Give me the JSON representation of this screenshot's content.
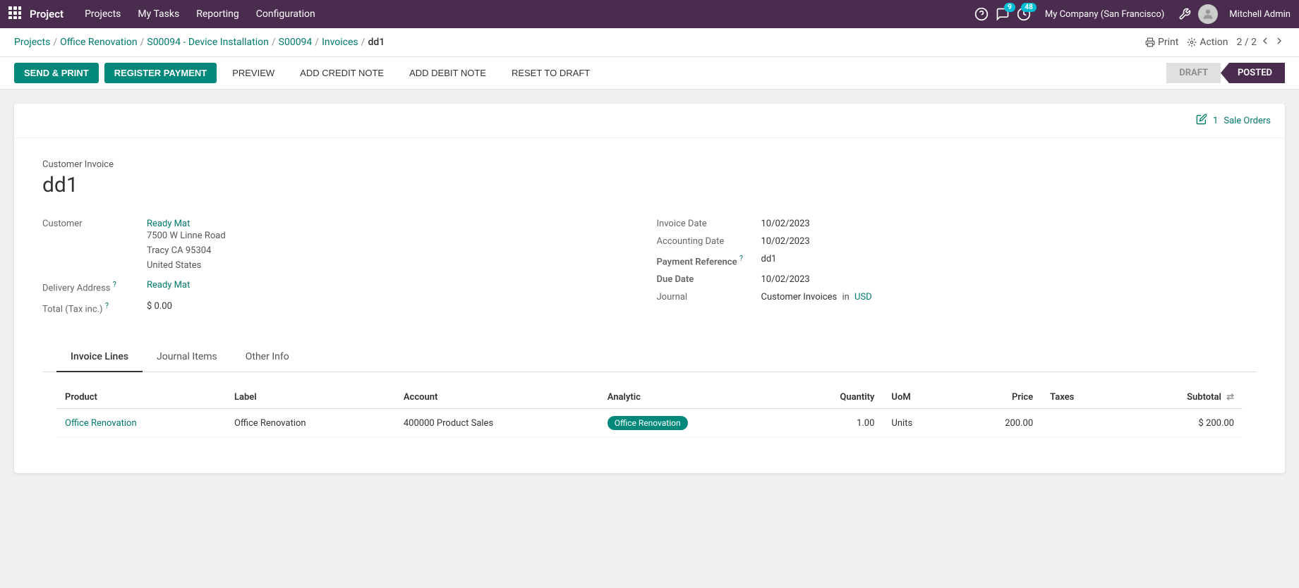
{
  "app": {
    "name": "Project",
    "nav_items": [
      "Projects",
      "My Tasks",
      "Reporting",
      "Configuration"
    ],
    "company": "My Company (San Francisco)",
    "user": "Mitchell Admin",
    "notifications_count": "9",
    "activity_count": "48"
  },
  "breadcrumb": {
    "items": [
      "Projects",
      "Office Renovation",
      "S00094 - Device Installation",
      "S00094",
      "Invoices",
      "dd1"
    ],
    "separators": [
      "/",
      "/",
      "/",
      "/",
      "/"
    ],
    "print_label": "Print",
    "action_label": "Action",
    "page_current": "2",
    "page_total": "2"
  },
  "toolbar": {
    "send_print_label": "SEND & PRINT",
    "register_payment_label": "REGISTER PAYMENT",
    "preview_label": "PREVIEW",
    "add_credit_note_label": "ADD CREDIT NOTE",
    "add_debit_note_label": "ADD DEBIT NOTE",
    "reset_to_draft_label": "RESET TO DRAFT",
    "status_draft": "DRAFT",
    "status_posted": "POSTED"
  },
  "sale_orders": {
    "count": "1",
    "label": "Sale Orders"
  },
  "invoice": {
    "type": "Customer Invoice",
    "title": "dd1",
    "customer_label": "Customer",
    "customer_name": "Ready Mat",
    "customer_address_line1": "7500 W Linne Road",
    "customer_address_line2": "Tracy CA 95304",
    "customer_address_line3": "United States",
    "delivery_address_label": "Delivery Address",
    "delivery_address_value": "Ready Mat",
    "total_label": "Total (Tax inc.)",
    "total_help": "?",
    "total_value": "$ 0.00",
    "invoice_date_label": "Invoice Date",
    "invoice_date_value": "10/02/2023",
    "accounting_date_label": "Accounting Date",
    "accounting_date_value": "10/02/2023",
    "payment_reference_label": "Payment Reference",
    "payment_reference_help": "?",
    "payment_reference_value": "dd1",
    "due_date_label": "Due Date",
    "due_date_value": "10/02/2023",
    "journal_label": "Journal",
    "journal_value": "Customer Invoices",
    "journal_in": "in",
    "journal_currency": "USD"
  },
  "tabs": {
    "items": [
      "Invoice Lines",
      "Journal Items",
      "Other Info"
    ],
    "active": "Invoice Lines"
  },
  "table": {
    "columns": [
      "Product",
      "Label",
      "Account",
      "Analytic",
      "Quantity",
      "UoM",
      "Price",
      "Taxes",
      "Subtotal"
    ],
    "rows": [
      {
        "product": "Office Renovation",
        "label": "Office Renovation",
        "account": "400000 Product Sales",
        "analytic": "Office Renovation",
        "quantity": "1.00",
        "uom": "Units",
        "price": "200.00",
        "taxes": "",
        "subtotal": "$ 200.00"
      }
    ]
  }
}
